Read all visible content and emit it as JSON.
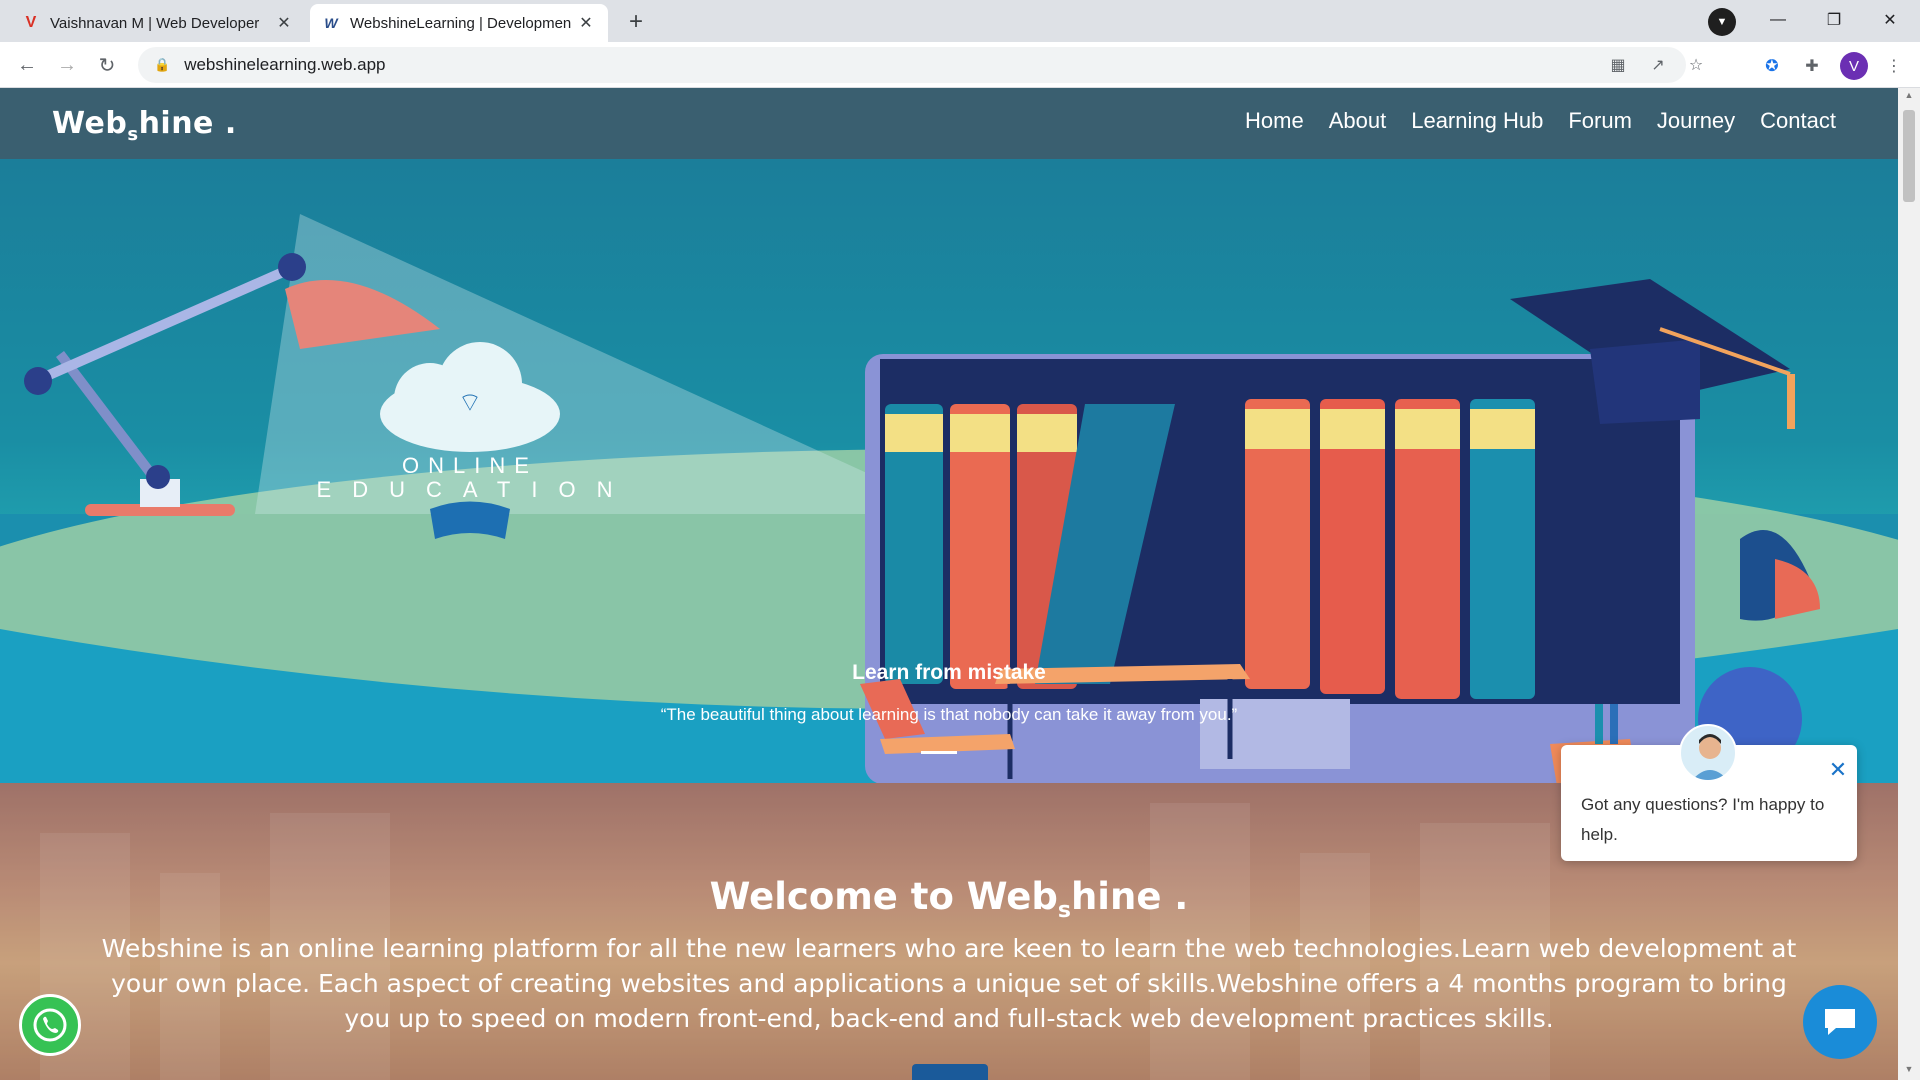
{
  "browser": {
    "tabs": [
      {
        "title": "Vaishnavan M | Web Developer",
        "favicon": "V"
      },
      {
        "title": "WebshineLearning | Developmen",
        "favicon": "W"
      }
    ],
    "url": "webshinelearning.web.app",
    "profile_initial": "V"
  },
  "site": {
    "logo_main": "Web",
    "logo_sub": "s",
    "logo_end": "hine .",
    "nav": [
      "Home",
      "About",
      "Learning Hub",
      "Forum",
      "Journey",
      "Contact"
    ]
  },
  "hero": {
    "illustration_line1": "ONLINE",
    "illustration_line2": "EDUCATION",
    "caption_title": "Learn from mistake",
    "caption_quote": "“The beautiful thing about learning is that nobody can take it away from you.”"
  },
  "welcome": {
    "title_main": "Welcome to Web",
    "title_sub": "s",
    "title_end": "hine .",
    "text": "Webshine is an online learning platform for all the new learners who are keen to learn the web technologies.Learn web development at your own place. Each aspect of creating websites and applications a unique set of skills.Webshine offers a 4 months program to bring you up to speed on modern front-end, back-end and full-stack web development practices skills."
  },
  "chat": {
    "message": "Got any questions? I'm happy to help."
  },
  "colors": {
    "navbar": "#3a5f70",
    "hero_teal": "#1a8ea4",
    "chat_blue": "#1a8cd8",
    "whatsapp_green": "#36c254"
  }
}
